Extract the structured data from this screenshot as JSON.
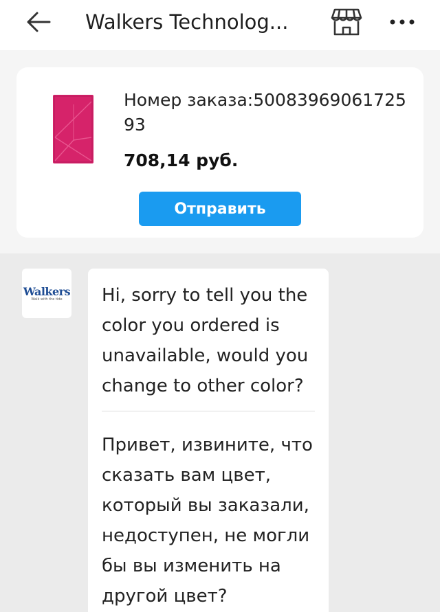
{
  "header": {
    "title": "Walkers Technolog...",
    "icons": {
      "back": "arrow-left-icon",
      "store": "store-icon",
      "more": "more-dots-icon"
    }
  },
  "order": {
    "number_text": "Номер заказа:5008396906172593",
    "price": "708,14 руб.",
    "send_label": "Отправить",
    "product_color": "#d6236a"
  },
  "chat": {
    "avatar": {
      "logo_text": "Walkers",
      "tagline": "Walk with the tide"
    },
    "message": {
      "text_en": "Hi, sorry to tell you the color you ordered is unavailable, would you change to other color?",
      "text_ru": "Привет, извините, что сказать вам цвет, который вы заказали, недоступен, не могли бы вы изменить на другой цвет?"
    }
  },
  "colors": {
    "accent": "#1a9bf0",
    "header_bg": "#ffffff",
    "order_bg": "#f5f5f5",
    "chat_bg": "#ebebeb",
    "brand_blue": "#1f4d94"
  }
}
